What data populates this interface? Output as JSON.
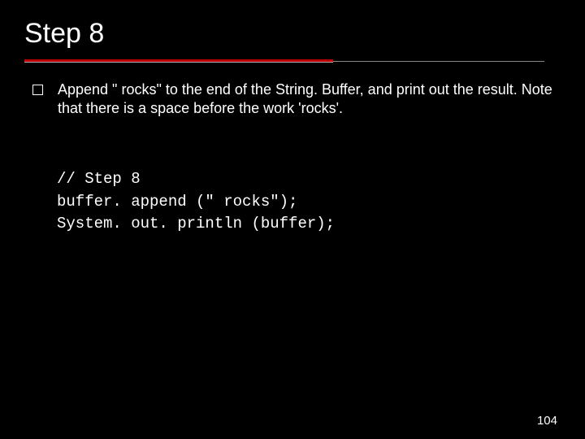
{
  "slide": {
    "title": "Step 8",
    "bullet": "Append \" rocks\" to the end of the String. Buffer, and print out the result. Note that there is a space before the work 'rocks'.",
    "code_line1": "// Step 8",
    "code_line2": "buffer. append (\" rocks\");",
    "code_line3": "System. out. println (buffer);",
    "page_number": "104"
  }
}
